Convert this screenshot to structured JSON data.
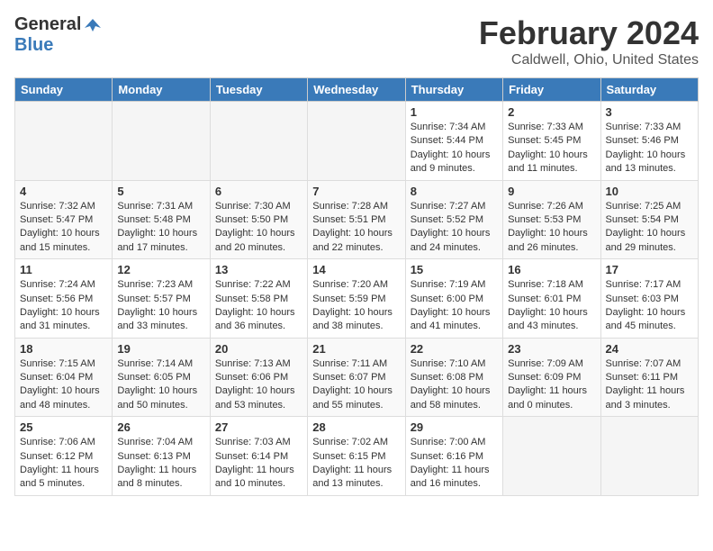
{
  "header": {
    "logo_general": "General",
    "logo_blue": "Blue",
    "month_title": "February 2024",
    "location": "Caldwell, Ohio, United States"
  },
  "days_of_week": [
    "Sunday",
    "Monday",
    "Tuesday",
    "Wednesday",
    "Thursday",
    "Friday",
    "Saturday"
  ],
  "weeks": [
    [
      {
        "day": "",
        "info": ""
      },
      {
        "day": "",
        "info": ""
      },
      {
        "day": "",
        "info": ""
      },
      {
        "day": "",
        "info": ""
      },
      {
        "day": "1",
        "info": "Sunrise: 7:34 AM\nSunset: 5:44 PM\nDaylight: 10 hours\nand 9 minutes."
      },
      {
        "day": "2",
        "info": "Sunrise: 7:33 AM\nSunset: 5:45 PM\nDaylight: 10 hours\nand 11 minutes."
      },
      {
        "day": "3",
        "info": "Sunrise: 7:33 AM\nSunset: 5:46 PM\nDaylight: 10 hours\nand 13 minutes."
      }
    ],
    [
      {
        "day": "4",
        "info": "Sunrise: 7:32 AM\nSunset: 5:47 PM\nDaylight: 10 hours\nand 15 minutes."
      },
      {
        "day": "5",
        "info": "Sunrise: 7:31 AM\nSunset: 5:48 PM\nDaylight: 10 hours\nand 17 minutes."
      },
      {
        "day": "6",
        "info": "Sunrise: 7:30 AM\nSunset: 5:50 PM\nDaylight: 10 hours\nand 20 minutes."
      },
      {
        "day": "7",
        "info": "Sunrise: 7:28 AM\nSunset: 5:51 PM\nDaylight: 10 hours\nand 22 minutes."
      },
      {
        "day": "8",
        "info": "Sunrise: 7:27 AM\nSunset: 5:52 PM\nDaylight: 10 hours\nand 24 minutes."
      },
      {
        "day": "9",
        "info": "Sunrise: 7:26 AM\nSunset: 5:53 PM\nDaylight: 10 hours\nand 26 minutes."
      },
      {
        "day": "10",
        "info": "Sunrise: 7:25 AM\nSunset: 5:54 PM\nDaylight: 10 hours\nand 29 minutes."
      }
    ],
    [
      {
        "day": "11",
        "info": "Sunrise: 7:24 AM\nSunset: 5:56 PM\nDaylight: 10 hours\nand 31 minutes."
      },
      {
        "day": "12",
        "info": "Sunrise: 7:23 AM\nSunset: 5:57 PM\nDaylight: 10 hours\nand 33 minutes."
      },
      {
        "day": "13",
        "info": "Sunrise: 7:22 AM\nSunset: 5:58 PM\nDaylight: 10 hours\nand 36 minutes."
      },
      {
        "day": "14",
        "info": "Sunrise: 7:20 AM\nSunset: 5:59 PM\nDaylight: 10 hours\nand 38 minutes."
      },
      {
        "day": "15",
        "info": "Sunrise: 7:19 AM\nSunset: 6:00 PM\nDaylight: 10 hours\nand 41 minutes."
      },
      {
        "day": "16",
        "info": "Sunrise: 7:18 AM\nSunset: 6:01 PM\nDaylight: 10 hours\nand 43 minutes."
      },
      {
        "day": "17",
        "info": "Sunrise: 7:17 AM\nSunset: 6:03 PM\nDaylight: 10 hours\nand 45 minutes."
      }
    ],
    [
      {
        "day": "18",
        "info": "Sunrise: 7:15 AM\nSunset: 6:04 PM\nDaylight: 10 hours\nand 48 minutes."
      },
      {
        "day": "19",
        "info": "Sunrise: 7:14 AM\nSunset: 6:05 PM\nDaylight: 10 hours\nand 50 minutes."
      },
      {
        "day": "20",
        "info": "Sunrise: 7:13 AM\nSunset: 6:06 PM\nDaylight: 10 hours\nand 53 minutes."
      },
      {
        "day": "21",
        "info": "Sunrise: 7:11 AM\nSunset: 6:07 PM\nDaylight: 10 hours\nand 55 minutes."
      },
      {
        "day": "22",
        "info": "Sunrise: 7:10 AM\nSunset: 6:08 PM\nDaylight: 10 hours\nand 58 minutes."
      },
      {
        "day": "23",
        "info": "Sunrise: 7:09 AM\nSunset: 6:09 PM\nDaylight: 11 hours\nand 0 minutes."
      },
      {
        "day": "24",
        "info": "Sunrise: 7:07 AM\nSunset: 6:11 PM\nDaylight: 11 hours\nand 3 minutes."
      }
    ],
    [
      {
        "day": "25",
        "info": "Sunrise: 7:06 AM\nSunset: 6:12 PM\nDaylight: 11 hours\nand 5 minutes."
      },
      {
        "day": "26",
        "info": "Sunrise: 7:04 AM\nSunset: 6:13 PM\nDaylight: 11 hours\nand 8 minutes."
      },
      {
        "day": "27",
        "info": "Sunrise: 7:03 AM\nSunset: 6:14 PM\nDaylight: 11 hours\nand 10 minutes."
      },
      {
        "day": "28",
        "info": "Sunrise: 7:02 AM\nSunset: 6:15 PM\nDaylight: 11 hours\nand 13 minutes."
      },
      {
        "day": "29",
        "info": "Sunrise: 7:00 AM\nSunset: 6:16 PM\nDaylight: 11 hours\nand 16 minutes."
      },
      {
        "day": "",
        "info": ""
      },
      {
        "day": "",
        "info": ""
      }
    ]
  ]
}
